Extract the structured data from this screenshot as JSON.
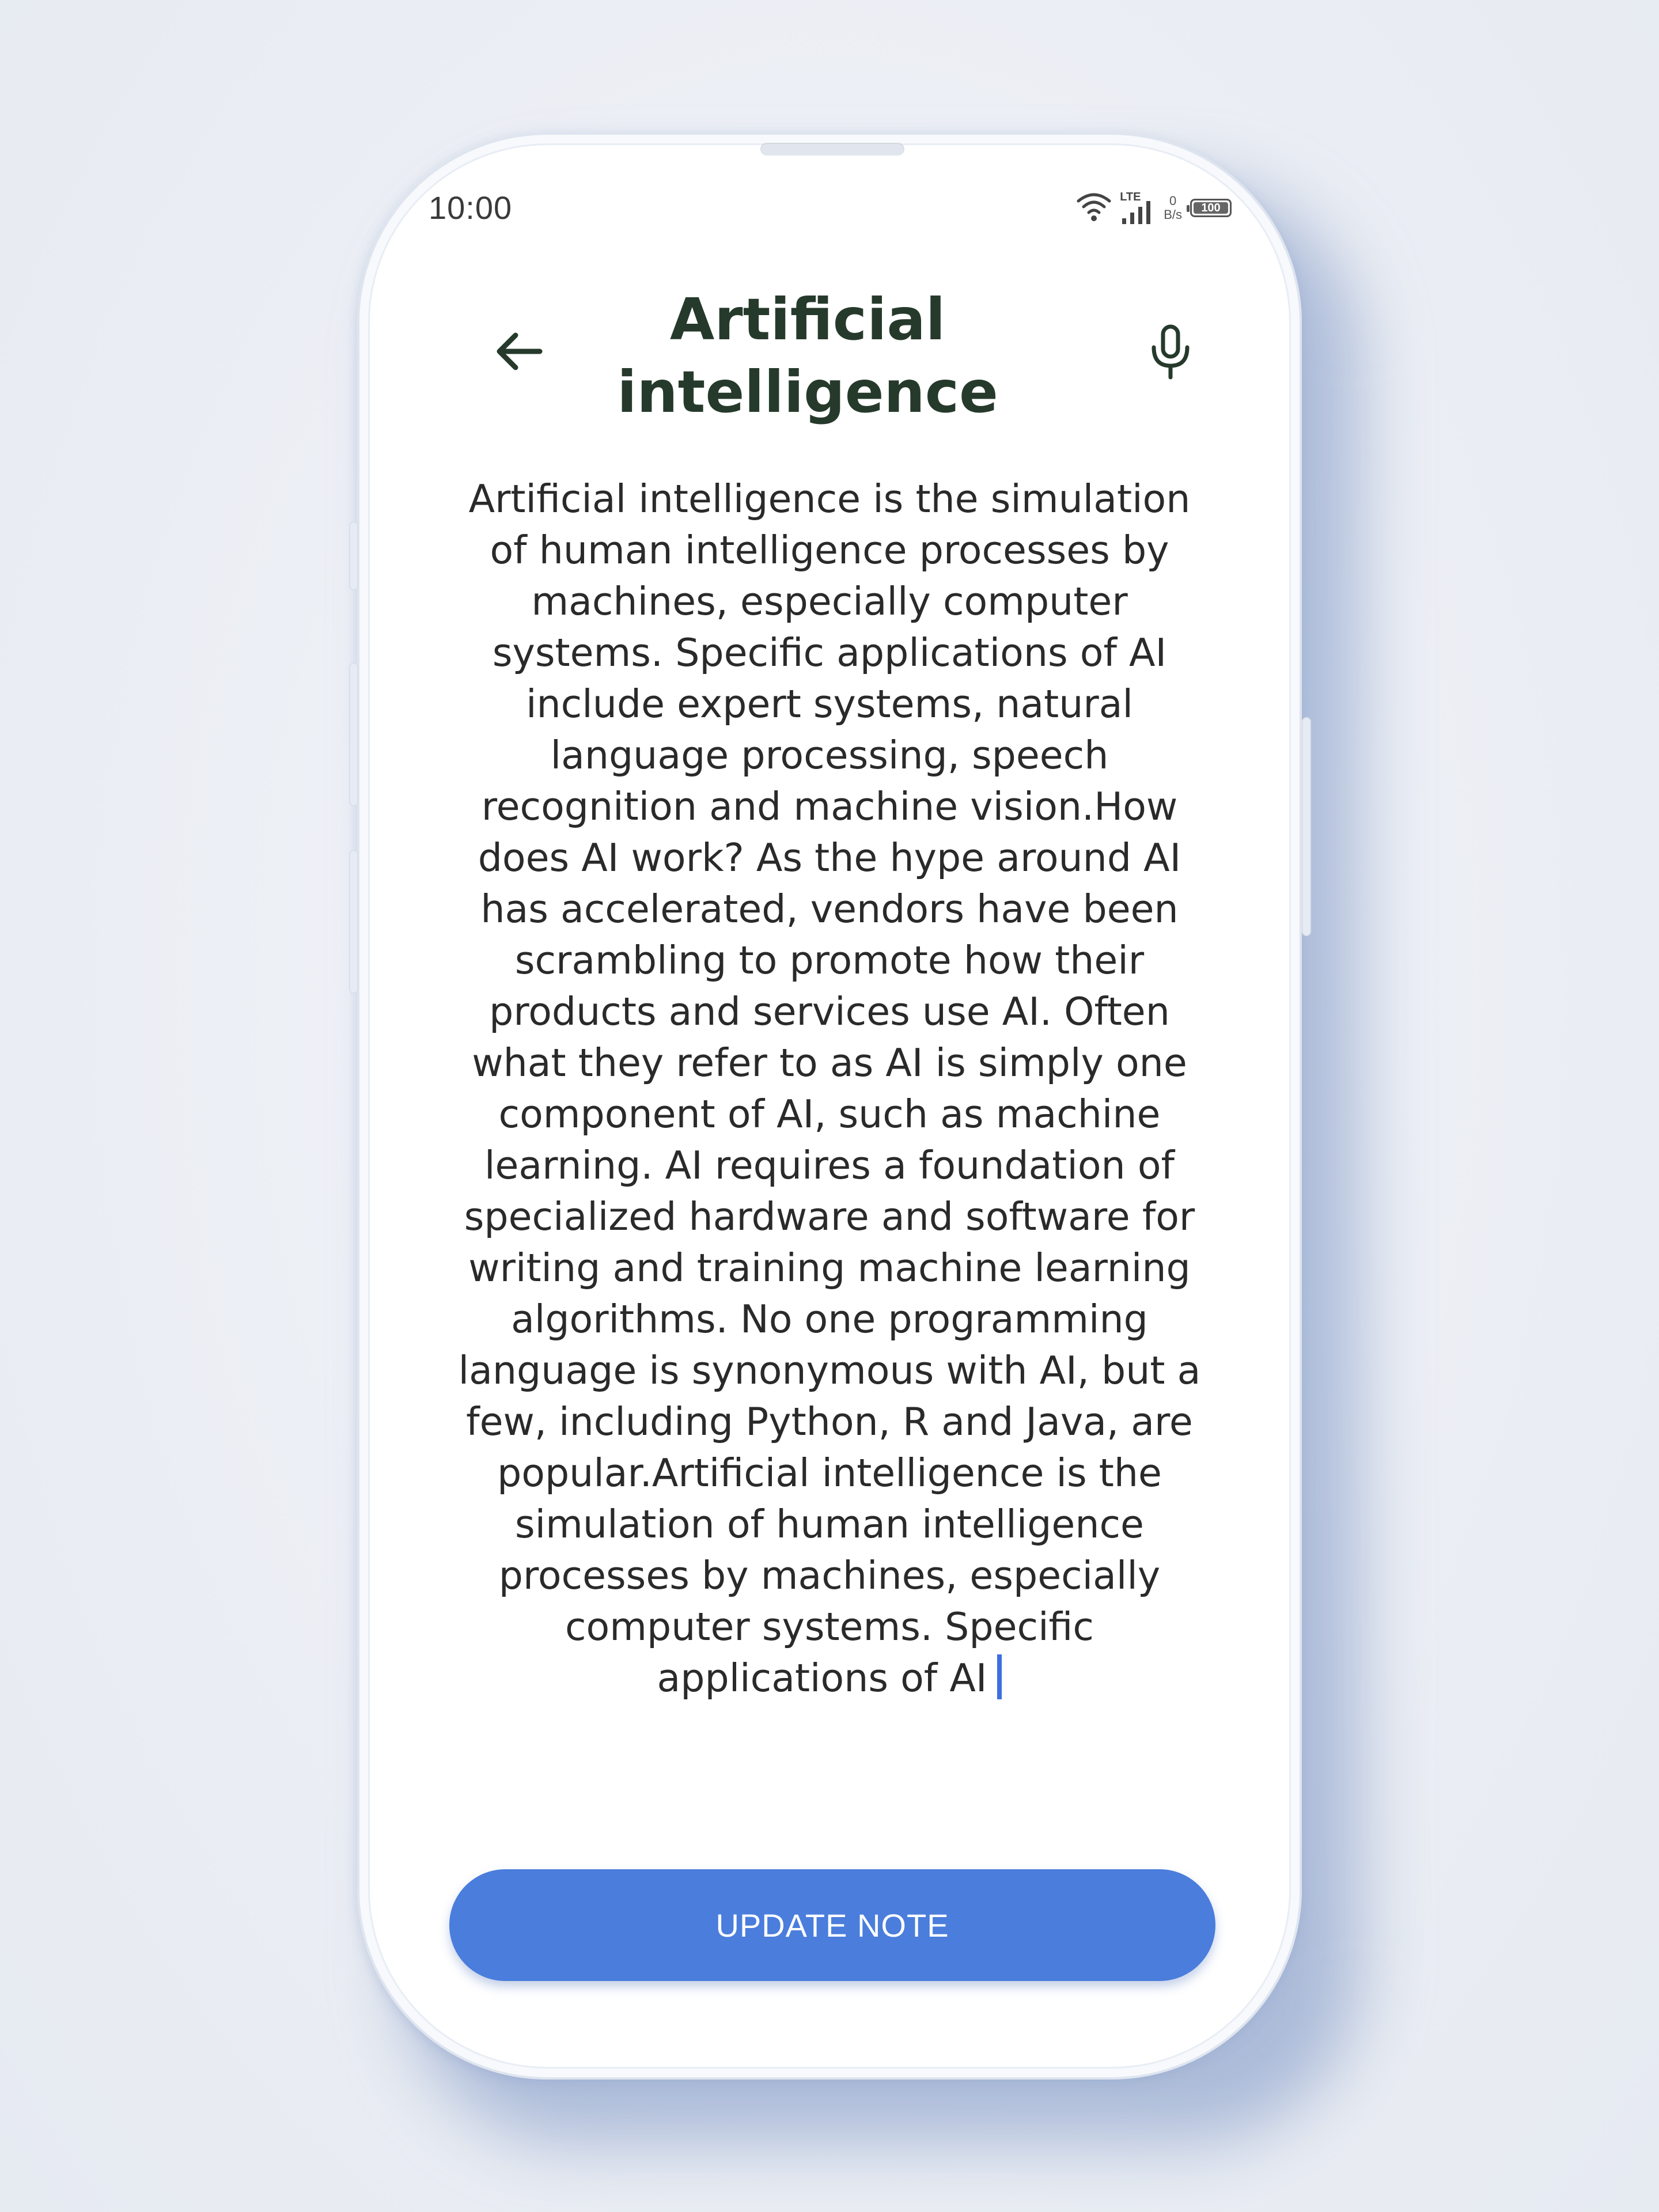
{
  "status_bar": {
    "time": "10:00",
    "network_label": "LTE",
    "speed_value": "0",
    "speed_unit": "B/s",
    "battery": "100"
  },
  "header": {
    "title": "Artificial intelligence",
    "back_icon": "arrow-left-icon",
    "mic_icon": "microphone-icon"
  },
  "note": {
    "content": "Artificial intelligence is the simulation of human intelligence processes by machines, especially computer systems. Specific applications of AI include expert systems, natural language processing, speech recognition and machine vision.How does AI work? As the hype around AI has accelerated, vendors have been scrambling to promote how their products and services use AI. Often what they refer to as AI is simply one component of AI, such as machine learning. AI requires a foundation of specialized hardware and software for writing and training machine learning algorithms. No one programming language is synonymous with AI, but a few, including Python, R and Java, are popular.Artificial intelligence is the simulation of human intelligence processes by machines, especially computer systems. Specific applications of AI"
  },
  "actions": {
    "update_label": "UPDATE NOTE"
  },
  "colors": {
    "title": "#263a2c",
    "button": "#4a7ddc",
    "caret": "#3d6fe0"
  }
}
